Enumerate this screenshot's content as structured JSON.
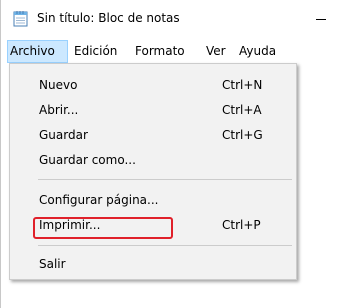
{
  "window": {
    "title": "Sin título: Bloc de notas",
    "icon": "notepad-icon"
  },
  "menubar": {
    "items": [
      {
        "label": "Archivo",
        "active": true
      },
      {
        "label": "Edición"
      },
      {
        "label": "Formato"
      },
      {
        "label": "Ver"
      },
      {
        "label": "Ayuda"
      }
    ]
  },
  "file_menu": {
    "items": [
      {
        "label": "Nuevo",
        "shortcut": "Ctrl+N"
      },
      {
        "label": "Abrir...",
        "shortcut": "Ctrl+A"
      },
      {
        "label": "Guardar",
        "shortcut": "Ctrl+G"
      },
      {
        "label": "Guardar como...",
        "shortcut": ""
      },
      {
        "label": "Configurar página...",
        "shortcut": ""
      },
      {
        "label": "Imprimir...",
        "shortcut": "Ctrl+P",
        "highlighted": true
      },
      {
        "label": "Salir",
        "shortcut": ""
      }
    ]
  },
  "colors": {
    "menu_active_bg": "#cce8ff",
    "dropdown_bg": "#f2f2f2",
    "highlight_border": "#e0202a"
  }
}
